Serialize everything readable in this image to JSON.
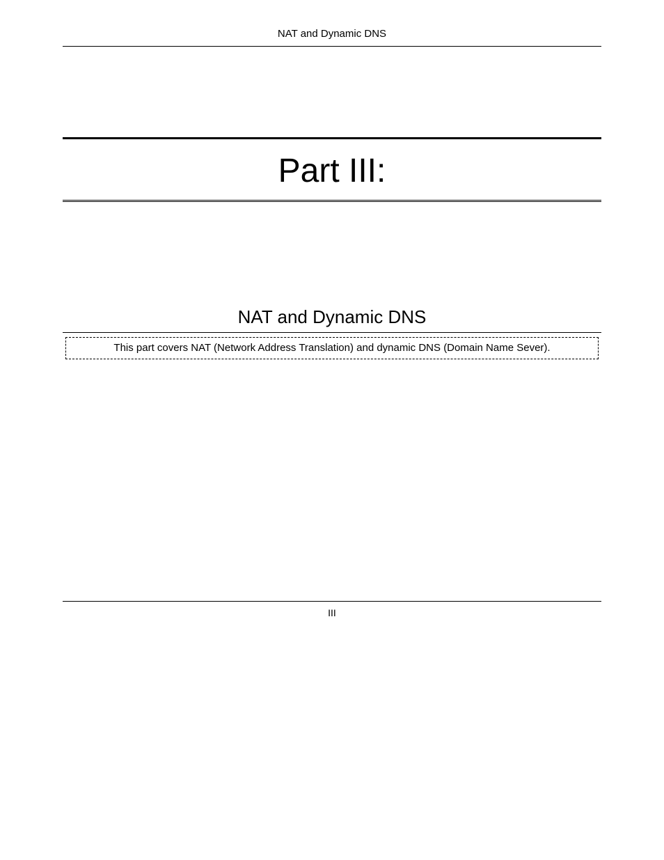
{
  "header": {
    "running_title": "NAT and Dynamic DNS"
  },
  "title": {
    "label": "Part III:"
  },
  "subtitle": {
    "label": "NAT and Dynamic DNS"
  },
  "description": {
    "text": "This part covers NAT (Network Address Translation) and dynamic DNS (Domain Name Sever)."
  },
  "footer": {
    "page_number": "III"
  }
}
